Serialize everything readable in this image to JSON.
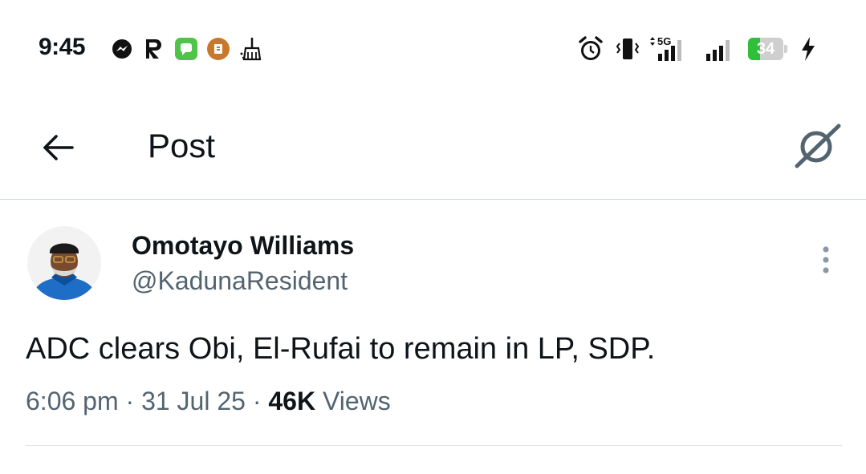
{
  "status_bar": {
    "time": "9:45",
    "network": "5G",
    "battery_percent": "34",
    "battery_level": 0.34,
    "icons": [
      "messenger-icon",
      "r-app-icon",
      "messages-icon",
      "notification-app-icon",
      "cleaner-icon",
      "alarm-icon",
      "vibrate-icon",
      "signal-icon",
      "signal-icon",
      "battery-icon",
      "charging-icon"
    ]
  },
  "header": {
    "title": "Post"
  },
  "post": {
    "author_name": "Omotayo Williams",
    "author_handle": "@KadunaResident",
    "text": "ADC clears Obi, El-Rufai to remain in LP, SDP.",
    "time": "6:06 pm",
    "date": "31 Jul 25",
    "views_count": "46K",
    "views_label": "Views",
    "separator": "·"
  },
  "colors": {
    "text_primary": "#0f1419",
    "text_secondary": "#536471",
    "divider": "#cfd9de",
    "battery_fill": "#2fbf3a"
  }
}
